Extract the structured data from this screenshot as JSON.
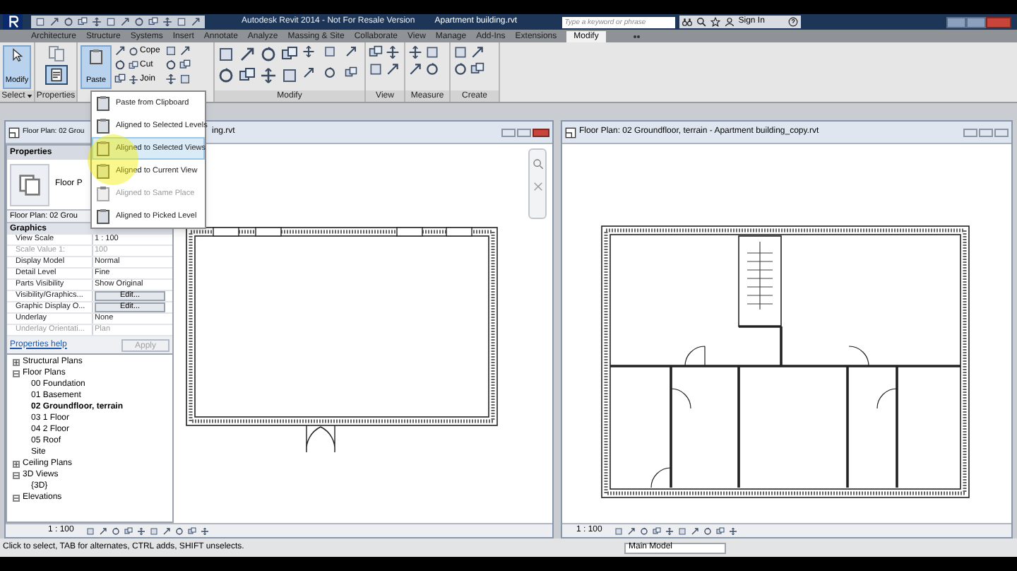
{
  "app_title": "Autodesk Revit 2014 - Not For Resale Version",
  "file_name": "Apartment building.rvt",
  "search": {
    "placeholder": "Type a keyword or phrase"
  },
  "sign_in": "Sign In",
  "ribbon_tabs": [
    {
      "label": "Architecture",
      "selected": false
    },
    {
      "label": "Structure",
      "selected": false
    },
    {
      "label": "Systems",
      "selected": false
    },
    {
      "label": "Insert",
      "selected": false
    },
    {
      "label": "Annotate",
      "selected": false
    },
    {
      "label": "Analyze",
      "selected": false
    },
    {
      "label": "Massing & Site",
      "selected": false
    },
    {
      "label": "Collaborate",
      "selected": false
    },
    {
      "label": "View",
      "selected": false
    },
    {
      "label": "Manage",
      "selected": false
    },
    {
      "label": "Add-Ins",
      "selected": false
    },
    {
      "label": "Extensions",
      "selected": false
    },
    {
      "label": "Modify",
      "selected": true
    }
  ],
  "ribbon": {
    "modify_button": {
      "label": "Modify",
      "pressed": true
    },
    "paste_button": {
      "label": "Paste",
      "pressed": true
    },
    "small_tools": [
      "Cope",
      "Cut",
      "Join"
    ],
    "panels": [
      {
        "label": "Select",
        "dropdown": true
      },
      {
        "label": "Properties",
        "dropdown": false
      },
      {
        "label": "Modify",
        "dropdown": false
      },
      {
        "label": "View",
        "dropdown": false
      },
      {
        "label": "Measure",
        "dropdown": false
      },
      {
        "label": "Create",
        "dropdown": false
      }
    ]
  },
  "paste_menu": [
    {
      "label": "Paste from Clipboard",
      "selected": false,
      "disabled": false
    },
    {
      "label": "Aligned to Selected Levels",
      "selected": false,
      "disabled": false
    },
    {
      "label": "Aligned to Selected Views",
      "selected": true,
      "disabled": false
    },
    {
      "label": "Aligned to Current View",
      "selected": false,
      "disabled": false
    },
    {
      "label": "Aligned to Same Place",
      "selected": false,
      "disabled": true
    },
    {
      "label": "Aligned to Picked Level",
      "selected": false,
      "disabled": false
    }
  ],
  "left_view": {
    "title_start": "Floor Plan: 02 Grou",
    "title_end": "ing.rvt",
    "scale": "1 : 100"
  },
  "properties": {
    "title": "Properties",
    "type_name": "Floor P",
    "instance": "Floor Plan: 02 Grou",
    "group": "Graphics",
    "rows": [
      {
        "name": "View Scale",
        "value": "1 : 100",
        "kind": "text",
        "disabled": false
      },
      {
        "name": "Scale Value    1:",
        "value": "100",
        "kind": "text",
        "disabled": true
      },
      {
        "name": "Display Model",
        "value": "Normal",
        "kind": "text",
        "disabled": false
      },
      {
        "name": "Detail Level",
        "value": "Fine",
        "kind": "text",
        "disabled": false
      },
      {
        "name": "Parts Visibility",
        "value": "Show Original",
        "kind": "text",
        "disabled": false
      },
      {
        "name": "Visibility/Graphics...",
        "value": "Edit...",
        "kind": "button",
        "disabled": false
      },
      {
        "name": "Graphic Display O...",
        "value": "Edit...",
        "kind": "button",
        "disabled": false
      },
      {
        "name": "Underlay",
        "value": "None",
        "kind": "text",
        "disabled": false
      },
      {
        "name": "Underlay Orientati...",
        "value": "Plan",
        "kind": "text",
        "disabled": true
      }
    ],
    "help_link": "Properties help",
    "apply": {
      "label": "Apply",
      "disabled": true
    }
  },
  "browser": [
    {
      "label": "Structural Plans",
      "expanded": false
    },
    {
      "label": "Floor Plans",
      "expanded": true,
      "children": [
        {
          "label": "00 Foundation",
          "selected": false
        },
        {
          "label": "01 Basement",
          "selected": false
        },
        {
          "label": "02 Groundfloor, terrain",
          "selected": true
        },
        {
          "label": "03 1 Floor",
          "selected": false
        },
        {
          "label": "04 2 Floor",
          "selected": false
        },
        {
          "label": "05 Roof",
          "selected": false
        },
        {
          "label": "Site",
          "selected": false
        }
      ]
    },
    {
      "label": "Ceiling Plans",
      "expanded": false
    },
    {
      "label": "3D Views",
      "expanded": true,
      "children": [
        {
          "label": "{3D}",
          "selected": false
        }
      ]
    },
    {
      "label": "Elevations",
      "expanded": true
    }
  ],
  "right_view": {
    "title": "Floor Plan: 02 Groundfloor, terrain - Apartment building_copy.rvt",
    "scale": "1 : 100"
  },
  "status_bar": {
    "message": "Click to select, TAB for alternates, CTRL adds, SHIFT unselects.",
    "model": "Main Model"
  }
}
